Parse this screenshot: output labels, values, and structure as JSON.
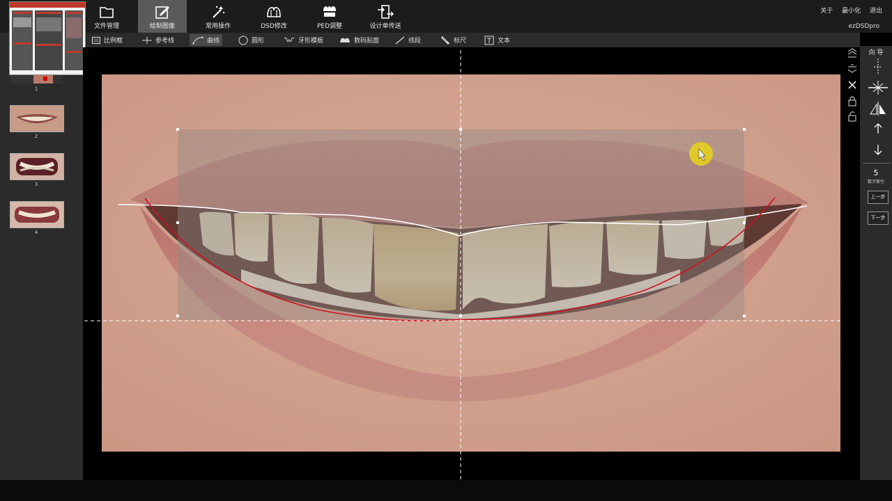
{
  "top_menu": [
    {
      "label": "文件管理",
      "icon": "folder-icon",
      "active": false
    },
    {
      "label": "绘制图像",
      "icon": "edit-icon",
      "active": true
    },
    {
      "label": "常用操作",
      "icon": "magic-wand-icon",
      "active": false
    },
    {
      "label": "DSD修改",
      "icon": "tooth-icon",
      "active": false
    },
    {
      "label": "PED调整",
      "icon": "ped-icon",
      "active": false
    },
    {
      "label": "设计单传送",
      "icon": "send-icon",
      "active": false
    }
  ],
  "window_controls": {
    "about": "关于",
    "minimize": "最小化",
    "exit": "退出"
  },
  "app_name": "ezDSDpro",
  "tools": [
    {
      "label": "比例框",
      "icon": "ratio-frame-icon"
    },
    {
      "label": "参考线",
      "icon": "reference-line-icon"
    },
    {
      "label": "曲线",
      "icon": "curve-icon"
    },
    {
      "label": "圆形",
      "icon": "circle-icon"
    },
    {
      "label": "牙形模板",
      "icon": "tooth-template-icon"
    },
    {
      "label": "数码贴面",
      "icon": "veneer-icon"
    },
    {
      "label": "线段",
      "icon": "line-segment-icon"
    },
    {
      "label": "标尺",
      "icon": "ruler-icon"
    },
    {
      "label": "文本",
      "icon": "text-icon"
    }
  ],
  "active_tool": "曲线",
  "thumbnails": [
    "1",
    "2",
    "3",
    "4"
  ],
  "right_panel": {
    "title": "向 导",
    "step_number": "5",
    "step_label": "数字索引",
    "prev_button": "上一步",
    "next_button": "下一步"
  },
  "colors": {
    "smile_curve": "#d0101e",
    "incisal_line": "#ffffff",
    "cursor_highlight": "#e8d21a",
    "active_menu_bg": "#5a5a5a"
  }
}
